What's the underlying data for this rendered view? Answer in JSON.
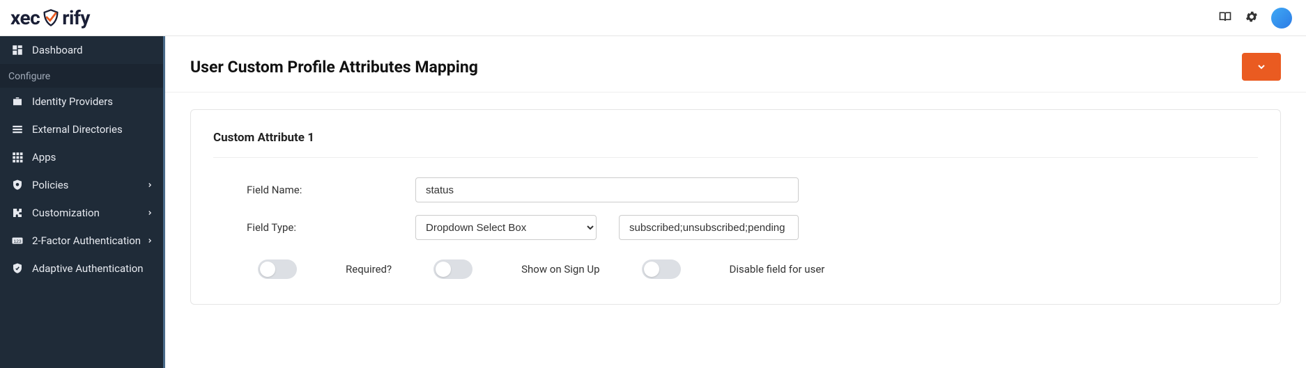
{
  "brand": {
    "name_pre": "xec",
    "name_post": "rify"
  },
  "header": {
    "title": "User Custom Profile Attributes Mapping"
  },
  "sidebar": {
    "items": [
      {
        "label": "Dashboard"
      },
      {
        "label": "Identity Providers"
      },
      {
        "label": "External Directories"
      },
      {
        "label": "Apps"
      },
      {
        "label": "Policies"
      },
      {
        "label": "Customization"
      },
      {
        "label": "2-Factor Authentication"
      },
      {
        "label": "Adaptive Authentication"
      }
    ],
    "section_label": "Configure"
  },
  "card": {
    "title": "Custom Attribute 1",
    "field_name_label": "Field Name:",
    "field_name_value": "status",
    "field_type_label": "Field Type:",
    "field_type_value": "Dropdown Select Box",
    "field_options_value": "subscribed;unsubscribed;pending",
    "toggles": {
      "required": "Required?",
      "show_signup": "Show on Sign Up",
      "disable_user": "Disable field for user"
    }
  }
}
